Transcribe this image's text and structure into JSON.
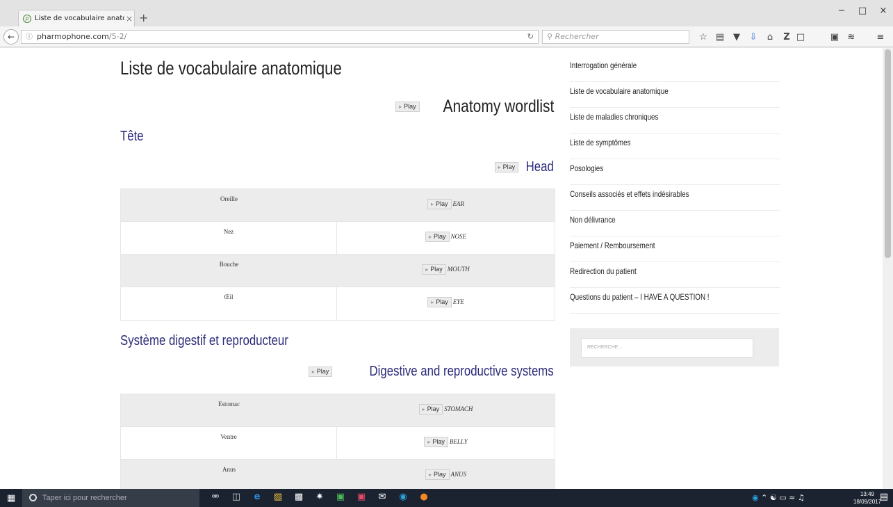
{
  "browser": {
    "tab_title": "Liste de vocabulaire anatom",
    "tab_close": "×",
    "new_tab": "+",
    "url_host": "pharmophone.com",
    "url_path": "/5-2/",
    "search_placeholder": "Rechercher",
    "window_controls": [
      "−",
      "□",
      "×"
    ]
  },
  "page": {
    "title": "Liste de vocabulaire anatomique",
    "subtitle_en": "Anatomy wordlist",
    "play_label": "Play",
    "sections": [
      {
        "title_fr": "Tête",
        "title_en": "Head",
        "rows": [
          {
            "fr": "Oreille",
            "en": "EAR"
          },
          {
            "fr": "Nez",
            "en": "NOSE"
          },
          {
            "fr": "Bouche",
            "en": "MOUTH"
          },
          {
            "fr": "Œil",
            "en": "EYE"
          }
        ]
      },
      {
        "title_fr": "Système digestif et reproducteur",
        "title_en": "Digestive and reproductive systems",
        "rows": [
          {
            "fr": "Estomac",
            "en": "STOMACH"
          },
          {
            "fr": "Ventre",
            "en": "BELLY"
          },
          {
            "fr": "Anus",
            "en": "ANUS"
          }
        ]
      }
    ]
  },
  "sidebar": {
    "items": [
      "Interrogation générale",
      "Liste de vocabulaire anatomique",
      "Liste de maladies chroniques",
      "Liste de symptômes",
      "Posologies",
      "Conseils associés et effets indésirables",
      "Non délivrance",
      "Paiement / Remboursement",
      "Redirection du patient",
      "Questions du patient – I HAVE A QUESTION !"
    ],
    "search_placeholder": "RECHERCHE..."
  },
  "taskbar": {
    "search_placeholder": "Taper ici pour rechercher",
    "time": "13:49",
    "date": "18/09/2017"
  },
  "colors": {
    "heading_blue": "#2b2a7a",
    "row_shade": "#ececec"
  }
}
